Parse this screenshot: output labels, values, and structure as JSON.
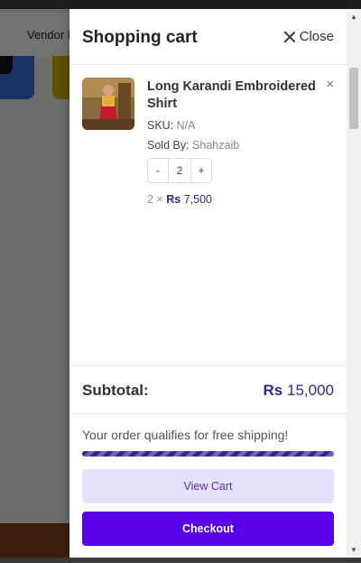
{
  "background": {
    "nav_text": "Vendor L"
  },
  "drawer": {
    "title": "Shopping cart",
    "close_label": "Close"
  },
  "cart_item": {
    "name": "Long Karandi Embroidered Shirt",
    "remove": "×",
    "sku_label": "SKU:",
    "sku_value": "N/A",
    "sold_by_label": "Sold By:",
    "sold_by_value": "Shahzaib",
    "qty_minus": "-",
    "qty_value": "2",
    "qty_plus": "+",
    "line_qty": "2 ×",
    "currency": "Rs",
    "price": "7,500"
  },
  "subtotal": {
    "label": "Subtotal:",
    "currency": "Rs",
    "value": "15,000"
  },
  "shipping": {
    "message": "Your order qualifies for free shipping!",
    "progress_percent": 100
  },
  "buttons": {
    "view_cart": "View Cart",
    "checkout": "Checkout"
  },
  "colors": {
    "accent": "#5a00e6",
    "price": "#2c2a8a",
    "view_cart_bg": "#e5e1fb"
  }
}
